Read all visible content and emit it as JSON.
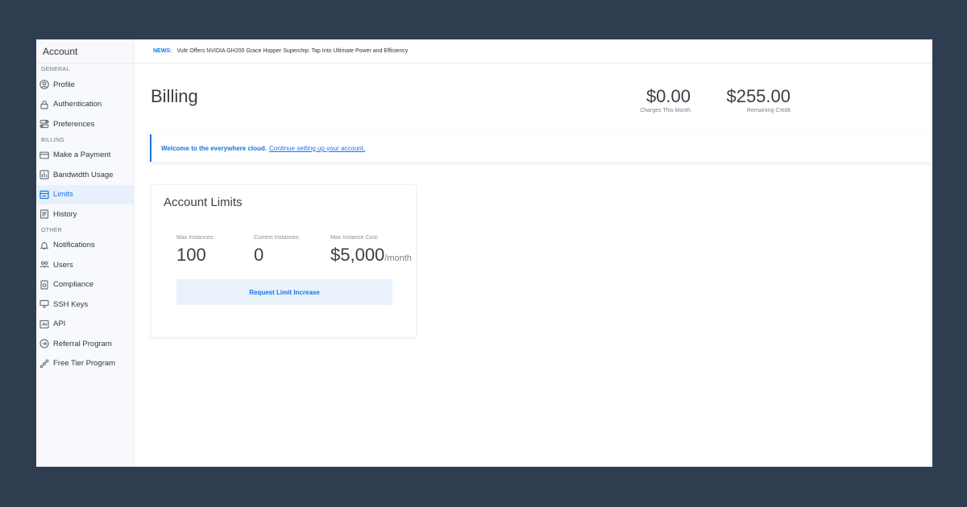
{
  "sidebar": {
    "title": "Account",
    "sections": {
      "general": "GENERAL",
      "billing": "BILLING",
      "other": "OTHER"
    },
    "items": {
      "profile": "Profile",
      "authentication": "Authentication",
      "preferences": "Preferences",
      "make_payment": "Make a Payment",
      "bandwidth": "Bandwidth Usage",
      "limits": "Limits",
      "history": "History",
      "notifications": "Notifications",
      "users": "Users",
      "compliance": "Compliance",
      "ssh_keys": "SSH Keys",
      "api": "API",
      "referral": "Referral Program",
      "free_tier": "Free Tier Program"
    },
    "active_item": "Limits"
  },
  "news": {
    "tag": "NEWS:",
    "text": "Vultr Offers NVIDIA GH200 Grace Hopper Superchip: Tap Into Ultimate Power and Efficiency"
  },
  "header": {
    "title": "Billing",
    "charges": {
      "value": "$0.00",
      "label": "Charges This Month"
    },
    "credit": {
      "value": "$255.00",
      "label": "Remaining Credit"
    }
  },
  "banner": {
    "strong": "Welcome to the everywhere cloud.",
    "link": "Continue setting up your account."
  },
  "limits_card": {
    "title": "Account Limits",
    "max_instances": {
      "label": "Max Instances:",
      "value": "100"
    },
    "current_instances": {
      "label": "Current Instances:",
      "value": "0"
    },
    "max_cost": {
      "label": "Max Instance Cost:",
      "value": "$5,000",
      "unit": "/month"
    },
    "button": "Request Limit Increase"
  },
  "colors": {
    "accent": "#1a73e8",
    "background": "#2f3d50",
    "sidebar": "#f7f9fc"
  }
}
